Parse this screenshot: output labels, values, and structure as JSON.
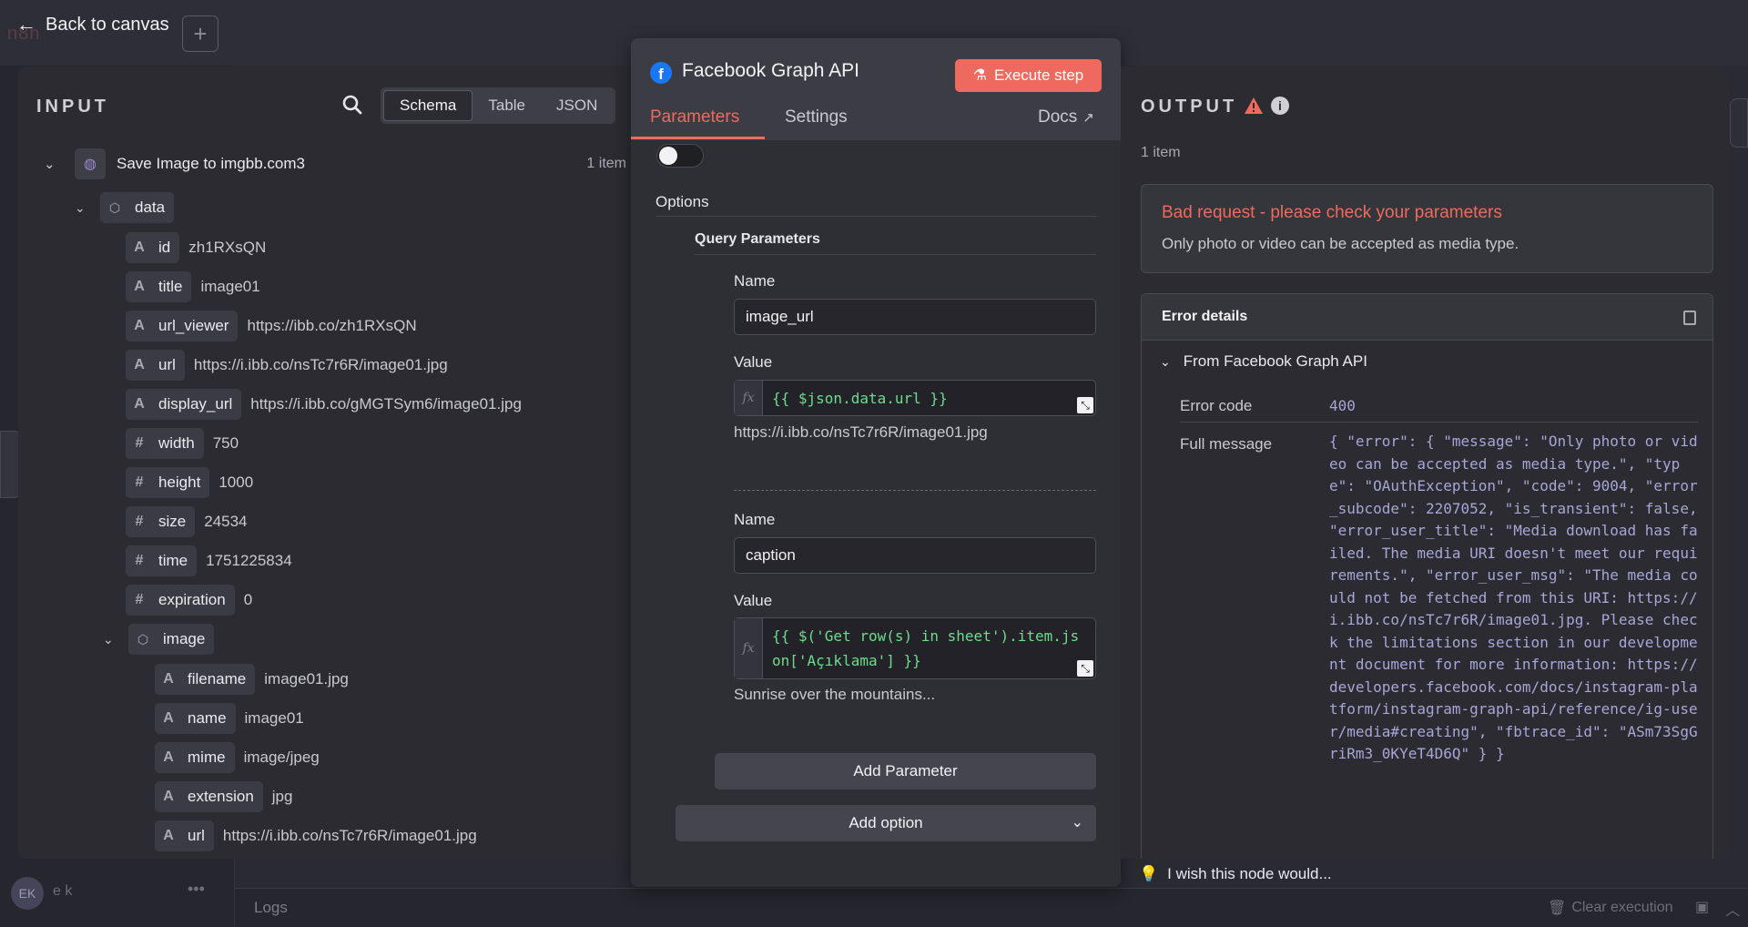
{
  "header": {
    "back_label": "Back to canvas",
    "brand": "n8n",
    "plus": "+"
  },
  "input": {
    "heading": "INPUT",
    "views": [
      "Schema",
      "Table",
      "JSON"
    ],
    "root": {
      "label": "Save Image to imgbb.com3",
      "count": "1 item"
    },
    "data_label": "data",
    "fields": [
      {
        "type": "A",
        "key": "id",
        "value": "zh1RXsQN"
      },
      {
        "type": "A",
        "key": "title",
        "value": "image01"
      },
      {
        "type": "A",
        "key": "url_viewer",
        "value": "https://ibb.co/zh1RXsQN"
      },
      {
        "type": "A",
        "key": "url",
        "value": "https://i.ibb.co/nsTc7r6R/image01.jpg"
      },
      {
        "type": "A",
        "key": "display_url",
        "value": "https://i.ibb.co/gMGTSym6/image01.jpg"
      },
      {
        "type": "#",
        "key": "width",
        "value": "750"
      },
      {
        "type": "#",
        "key": "height",
        "value": "1000"
      },
      {
        "type": "#",
        "key": "size",
        "value": "24534"
      },
      {
        "type": "#",
        "key": "time",
        "value": "1751225834"
      },
      {
        "type": "#",
        "key": "expiration",
        "value": "0"
      }
    ],
    "image_label": "image",
    "image_fields": [
      {
        "type": "A",
        "key": "filename",
        "value": "image01.jpg"
      },
      {
        "type": "A",
        "key": "name",
        "value": "image01"
      },
      {
        "type": "A",
        "key": "mime",
        "value": "image/jpeg"
      },
      {
        "type": "A",
        "key": "extension",
        "value": "jpg"
      },
      {
        "type": "A",
        "key": "url",
        "value": "https://i.ibb.co/nsTc7r6R/image01.jpg"
      }
    ]
  },
  "node": {
    "title": "Facebook Graph API",
    "execute_label": "Execute step",
    "tabs": [
      "Parameters",
      "Settings"
    ],
    "docs_label": "Docs",
    "options_label": "Options",
    "query_params_label": "Query Parameters",
    "param1": {
      "name_label": "Name",
      "name_value": "image_url",
      "value_label": "Value",
      "expression": "{{ $json.data.url }}",
      "resolved": "https://i.ibb.co/nsTc7r6R/image01.jpg"
    },
    "param2": {
      "name_label": "Name",
      "name_value": "caption",
      "value_label": "Value",
      "expression": "{{ $('Get row(s) in sheet').item.json['Açıklama'] }}",
      "resolved": "Sunrise over the mountains..."
    },
    "fx": "fx",
    "add_parameter": "Add Parameter",
    "add_option": "Add option"
  },
  "output": {
    "heading": "OUTPUT",
    "count": "1 item",
    "error_title": "Bad request - please check your parameters",
    "error_desc": "Only photo or video can be accepted as media type.",
    "details_title": "Error details",
    "from_label": "From Facebook Graph API",
    "error_code_label": "Error code",
    "error_code": "400",
    "full_message_label": "Full message",
    "full_message": "{ \"error\": { \"message\": \"Only photo or video can be accepted as media type.\", \"type\": \"OAuthException\", \"code\": 9004, \"error_subcode\": 2207052, \"is_transient\": false, \"error_user_title\": \"Media download has failed. The media URI doesn't meet our requirements.\", \"error_user_msg\": \"The media could not be fetched from this URI: https://i.ibb.co/nsTc7r6R/image01.jpg. Please check the limitations section in our development document for more information: https://developers.facebook.com/docs/instagram-platform/instagram-graph-api/reference/ig-user/media#creating\", \"fbtrace_id\": \"ASm73SgGriRm3_0KYeT4D6Q\" } }"
  },
  "footer": {
    "wish": "I wish this node would...",
    "logs": "Logs",
    "clear_execution": "Clear execution",
    "user_initials": "EK",
    "user_name": "e k"
  },
  "colors": {
    "accent": "#ef6a5e",
    "json_value": "#a6a6d8",
    "expr_green": "#6fdc8c",
    "facebook": "#1877f2"
  }
}
